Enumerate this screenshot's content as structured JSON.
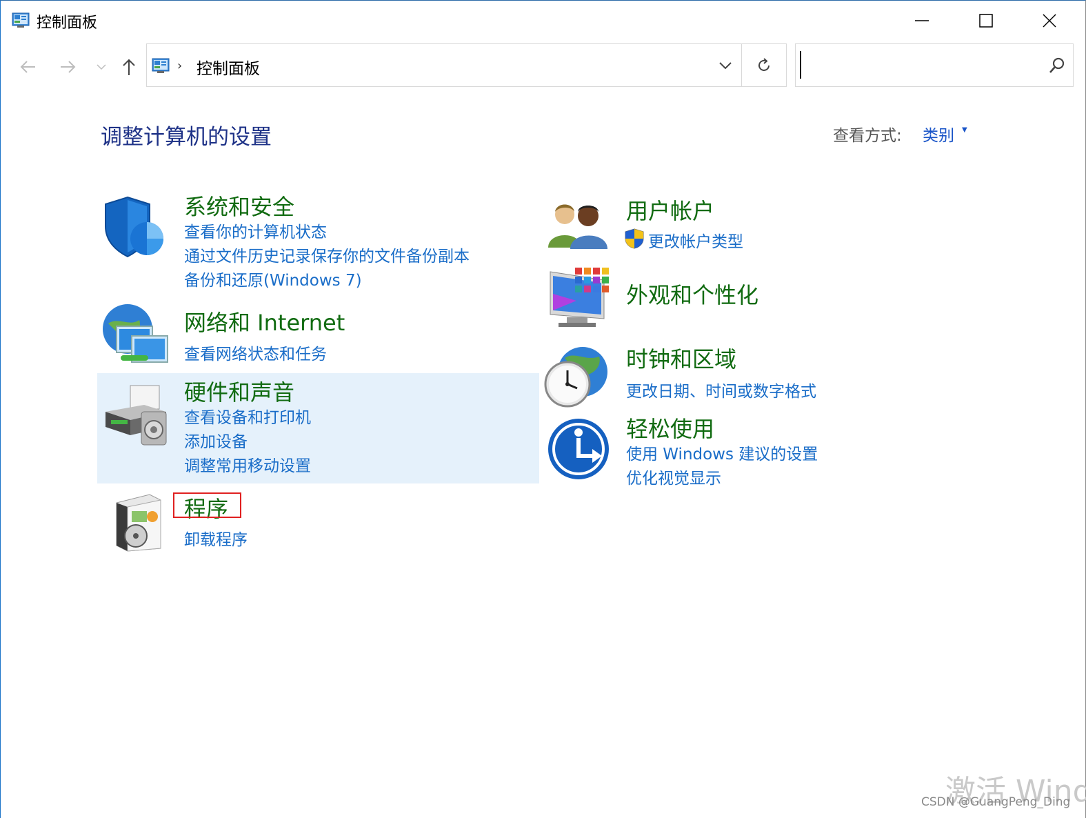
{
  "window": {
    "title": "控制面板",
    "icons": {
      "app": "control-panel-icon",
      "minimize": "minimize-icon",
      "maximize": "maximize-icon",
      "close": "close-icon"
    }
  },
  "nav": {
    "back_icon": "arrow-left-icon",
    "forward_icon": "arrow-right-icon",
    "recent_icon": "chevron-down-icon",
    "up_icon": "arrow-up-icon"
  },
  "address_bar": {
    "path": "控制面板",
    "dropdown_icon": "chevron-down-icon",
    "refresh_icon": "refresh-icon"
  },
  "search": {
    "value": "",
    "placeholder": "",
    "icon": "search-icon"
  },
  "main": {
    "heading": "调整计算机的设置",
    "view_by_label": "查看方式:",
    "view_by_value": "类别"
  },
  "categories": {
    "system_security": {
      "title": "系统和安全",
      "links": [
        "查看你的计算机状态",
        "通过文件历史记录保存你的文件备份副本",
        "备份和还原(Windows 7)"
      ]
    },
    "network": {
      "title": "网络和 Internet",
      "links": [
        "查看网络状态和任务"
      ]
    },
    "hardware": {
      "title": "硬件和声音",
      "links": [
        "查看设备和打印机",
        "添加设备",
        "调整常用移动设置"
      ]
    },
    "programs": {
      "title": "程序",
      "links": [
        "卸载程序"
      ]
    },
    "user_accounts": {
      "title": "用户帐户",
      "links": [
        "更改帐户类型"
      ]
    },
    "appearance": {
      "title": "外观和个性化",
      "links": []
    },
    "clock_region": {
      "title": "时钟和区域",
      "links": [
        "更改日期、时间或数字格式"
      ]
    },
    "ease_of_access": {
      "title": "轻松使用",
      "links": [
        "使用 Windows 建议的设置",
        "优化视觉显示"
      ]
    }
  },
  "watermark": {
    "activate": "激活 Wind",
    "credit": "CSDN @GuangPeng_Ding"
  },
  "colors": {
    "category_title": "#116b11",
    "link": "#1a6dc8",
    "heading": "#1e3287",
    "hover_bg": "#e5f1fb",
    "highlight_box": "#e02020"
  }
}
